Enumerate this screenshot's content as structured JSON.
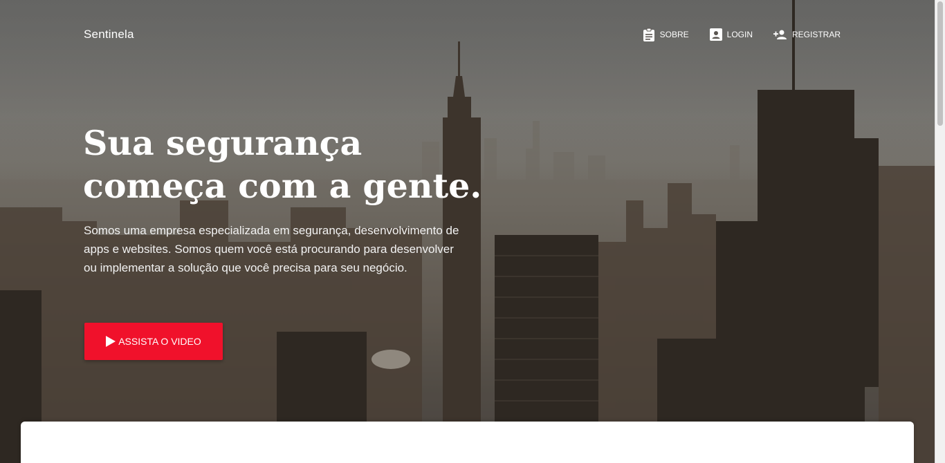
{
  "header": {
    "brand": "Sentinela",
    "nav": [
      {
        "label": "SOBRE",
        "icon": "clipboard-icon"
      },
      {
        "label": "LOGIN",
        "icon": "account-box-icon"
      },
      {
        "label": "REGISTRAR",
        "icon": "person-add-icon"
      }
    ]
  },
  "hero": {
    "headline_line1": "Sua segurança",
    "headline_line2": "começa com a gente.",
    "lead": "Somos uma empresa especializada em segurança, desenvolvimento de apps e websites. Somos quem você está procurando para desenvolver ou implementar a solução que você precisa para seu negócio.",
    "cta_label": "ASSISTA O VIDEO",
    "cta_icon": "play-icon"
  },
  "colors": {
    "accent": "#f0112b",
    "text_on_hero": "#ffffff"
  }
}
